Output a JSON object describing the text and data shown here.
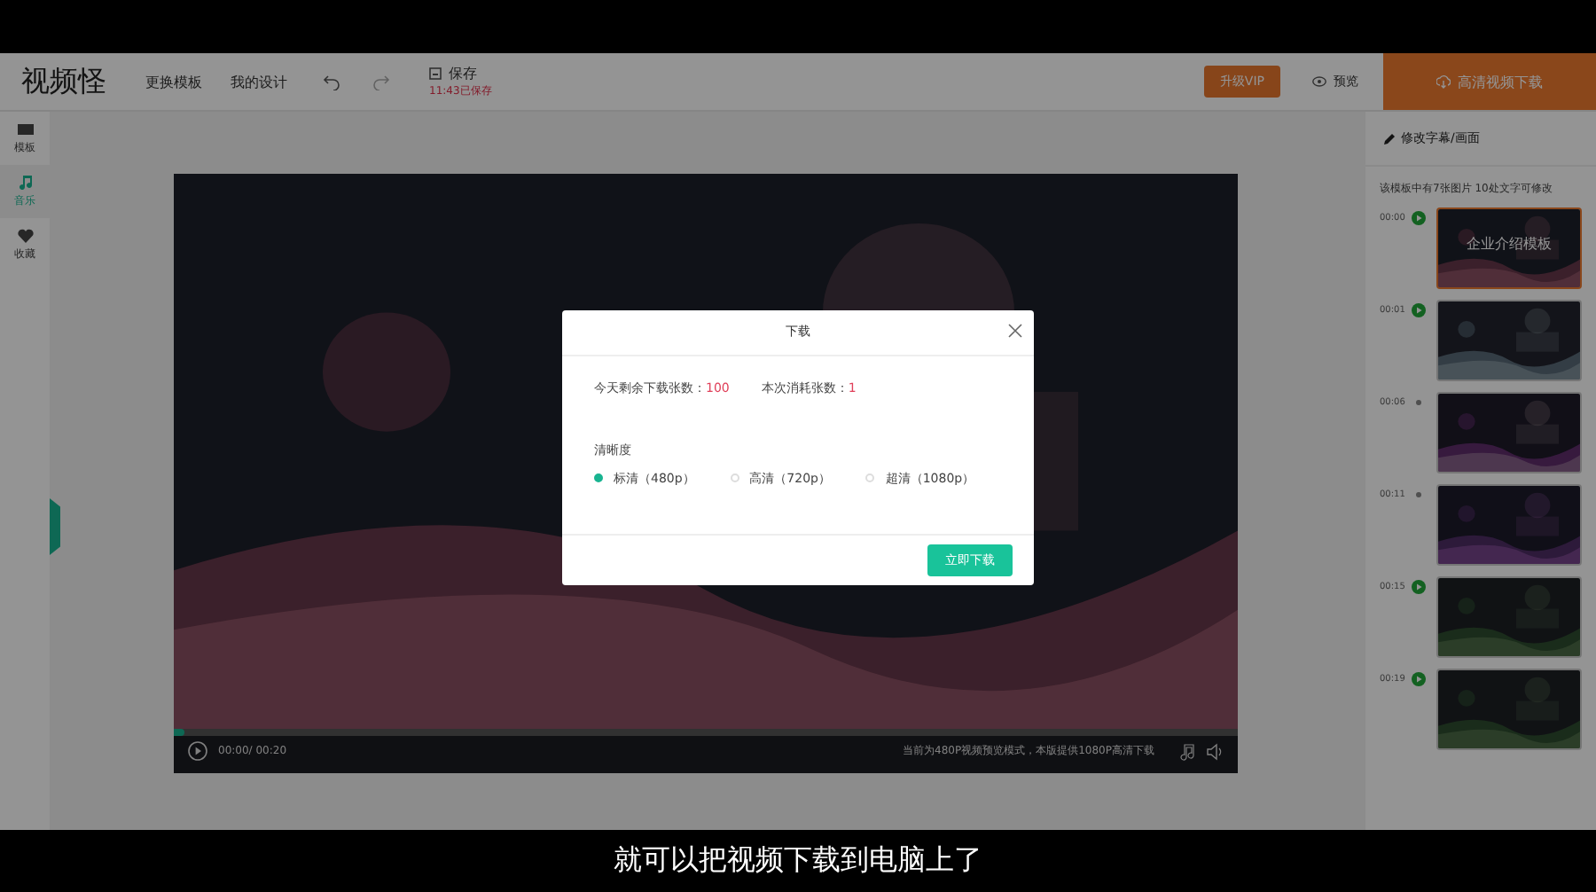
{
  "topbar": {
    "logo": "视频怪",
    "menu": [
      "更换模板",
      "我的设计"
    ],
    "save": {
      "label": "保存",
      "status": "11:43已保存"
    },
    "vip_button": "升级VIP",
    "preview": "预览",
    "download_button": "高清视频下载"
  },
  "sidebar": {
    "items": [
      {
        "label": "模板",
        "selected": false
      },
      {
        "label": "音乐",
        "selected": true
      },
      {
        "label": "收藏",
        "selected": false
      }
    ]
  },
  "player": {
    "time": "00:00/ 00:20",
    "notice": "当前为480P视频预览模式，本版提供1080P高清下载",
    "progress": {
      "level": 0.01
    }
  },
  "panel": {
    "title": "修改字幕/画面",
    "hint": "该模板中有7张图片 10处文字可修改",
    "slides": [
      {
        "time": "00:00",
        "kind": "play",
        "selected": true,
        "title": "企业介绍模板"
      },
      {
        "time": "00:01",
        "kind": "play",
        "selected": false
      },
      {
        "time": "00:06",
        "kind": "dot",
        "selected": false
      },
      {
        "time": "00:11",
        "kind": "dot",
        "selected": false
      },
      {
        "time": "00:15",
        "kind": "play",
        "selected": false
      },
      {
        "time": "00:19",
        "kind": "play",
        "selected": false
      }
    ]
  },
  "dialog": {
    "title": "下载",
    "stats": [
      {
        "label": "今天剩余下载张数：",
        "value": "100"
      },
      {
        "label": "本次消耗张数：",
        "value": "1"
      }
    ],
    "quality_label": "清晰度",
    "options": [
      {
        "label": "标清（480p）",
        "selected": true
      },
      {
        "label": "高清（720p）",
        "selected": false
      },
      {
        "label": "超清（1080p）",
        "selected": false
      }
    ],
    "confirm": "立即下载"
  },
  "subtitle": "就可以把视频下载到电脑上了"
}
